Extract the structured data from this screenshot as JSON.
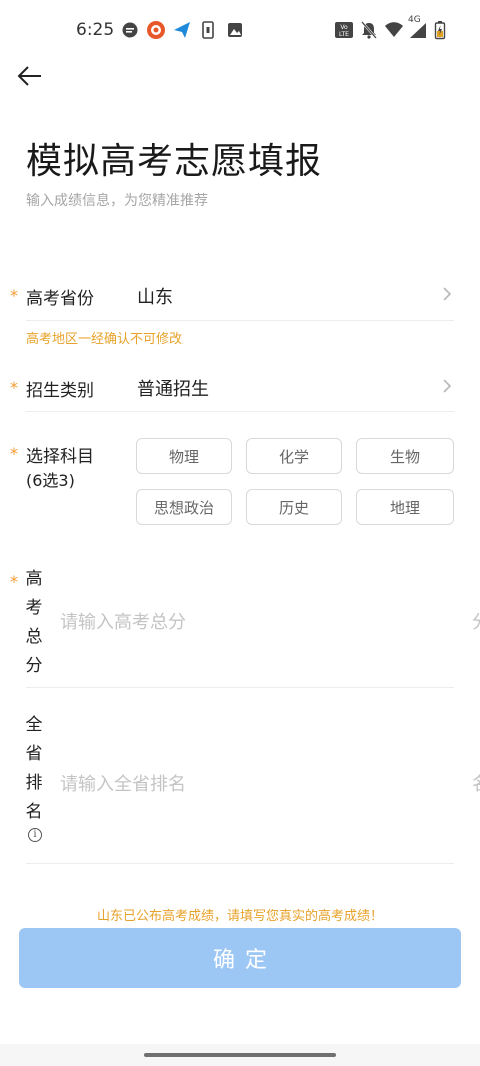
{
  "status_bar": {
    "time": "6:25",
    "network": "4G",
    "icons": [
      "message-icon",
      "app-icon",
      "send-icon",
      "sim-icon",
      "image-icon",
      "volte-icon",
      "mute-icon",
      "wifi-icon",
      "signal-icon",
      "battery-icon"
    ]
  },
  "header": {
    "back_icon": "arrow-left-icon",
    "title": "模拟高考志愿填报",
    "subtitle": "输入成绩信息，为您精准推荐"
  },
  "form": {
    "required_mark": "*",
    "province": {
      "label": "高考省份",
      "value": "山东",
      "warning": "高考地区一经确认不可修改"
    },
    "category": {
      "label": "招生类别",
      "value": "普通招生"
    },
    "subjects": {
      "label_line1": "选择科目",
      "label_line2": "(6选3)",
      "options": [
        "物理",
        "化学",
        "生物",
        "思想政治",
        "历史",
        "地理"
      ]
    },
    "total_score": {
      "label_chars": [
        "高",
        "考",
        "总",
        "分"
      ],
      "placeholder": "请输入高考总分",
      "suffix": "分"
    },
    "rank": {
      "label_chars": [
        "全",
        "省",
        "排",
        "名"
      ],
      "placeholder": "请输入全省排名",
      "suffix": "名",
      "info_icon": "info-icon",
      "info_glyph": "i"
    }
  },
  "notice": "山东已公布高考成绩，请填写您真实的高考成绩！",
  "confirm_label": "确定",
  "colors": {
    "accent_orange": "#e7a22b",
    "button_blue": "#9cc7f5",
    "placeholder": "#c4c4c4"
  }
}
